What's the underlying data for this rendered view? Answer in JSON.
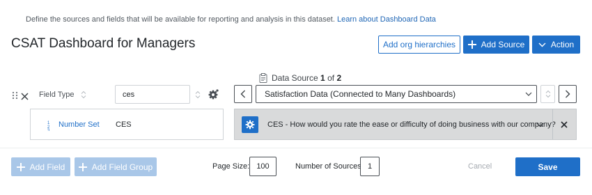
{
  "intro": {
    "text": "Define the sources and fields that will be available for reporting and analysis in this dataset.",
    "link": "Learn about Dashboard Data"
  },
  "page_title": "CSAT Dashboard for Managers",
  "header_actions": {
    "org_hierarchies": "Add org hierarchies",
    "add_source": "Add Source",
    "action": "Action"
  },
  "data_source": {
    "label": "Data Source",
    "index": "1",
    "of": "of",
    "total": "2",
    "selected": "Satisfaction Data (Connected to Many Dashboards)"
  },
  "field": {
    "type_label": "Field Type",
    "name_value": "ces",
    "subtype": "Number Set",
    "subtype_value": "CES"
  },
  "mapping": {
    "text": "CES - How would you rate the ease or difficulty of doing business with our company?"
  },
  "footer": {
    "add_field": "Add Field",
    "add_field_group": "Add Field Group",
    "page_size_label": "Page Size:",
    "page_size": "100",
    "sources_label": "Number of Sources:",
    "sources": "1",
    "cancel": "Cancel",
    "save": "Save"
  },
  "colors": {
    "primary": "#1f6fc8",
    "disabled": "#a9c7e8",
    "mapping_bg": "#d9dadb"
  },
  "icons": [
    "drag-handle-icon",
    "close-icon",
    "sort-icon",
    "gear-icon",
    "clipboard-icon",
    "chevron-left-icon",
    "chevron-right-icon",
    "chevron-down-icon",
    "plus-icon",
    "number-set-icon",
    "settings-square-icon"
  ]
}
